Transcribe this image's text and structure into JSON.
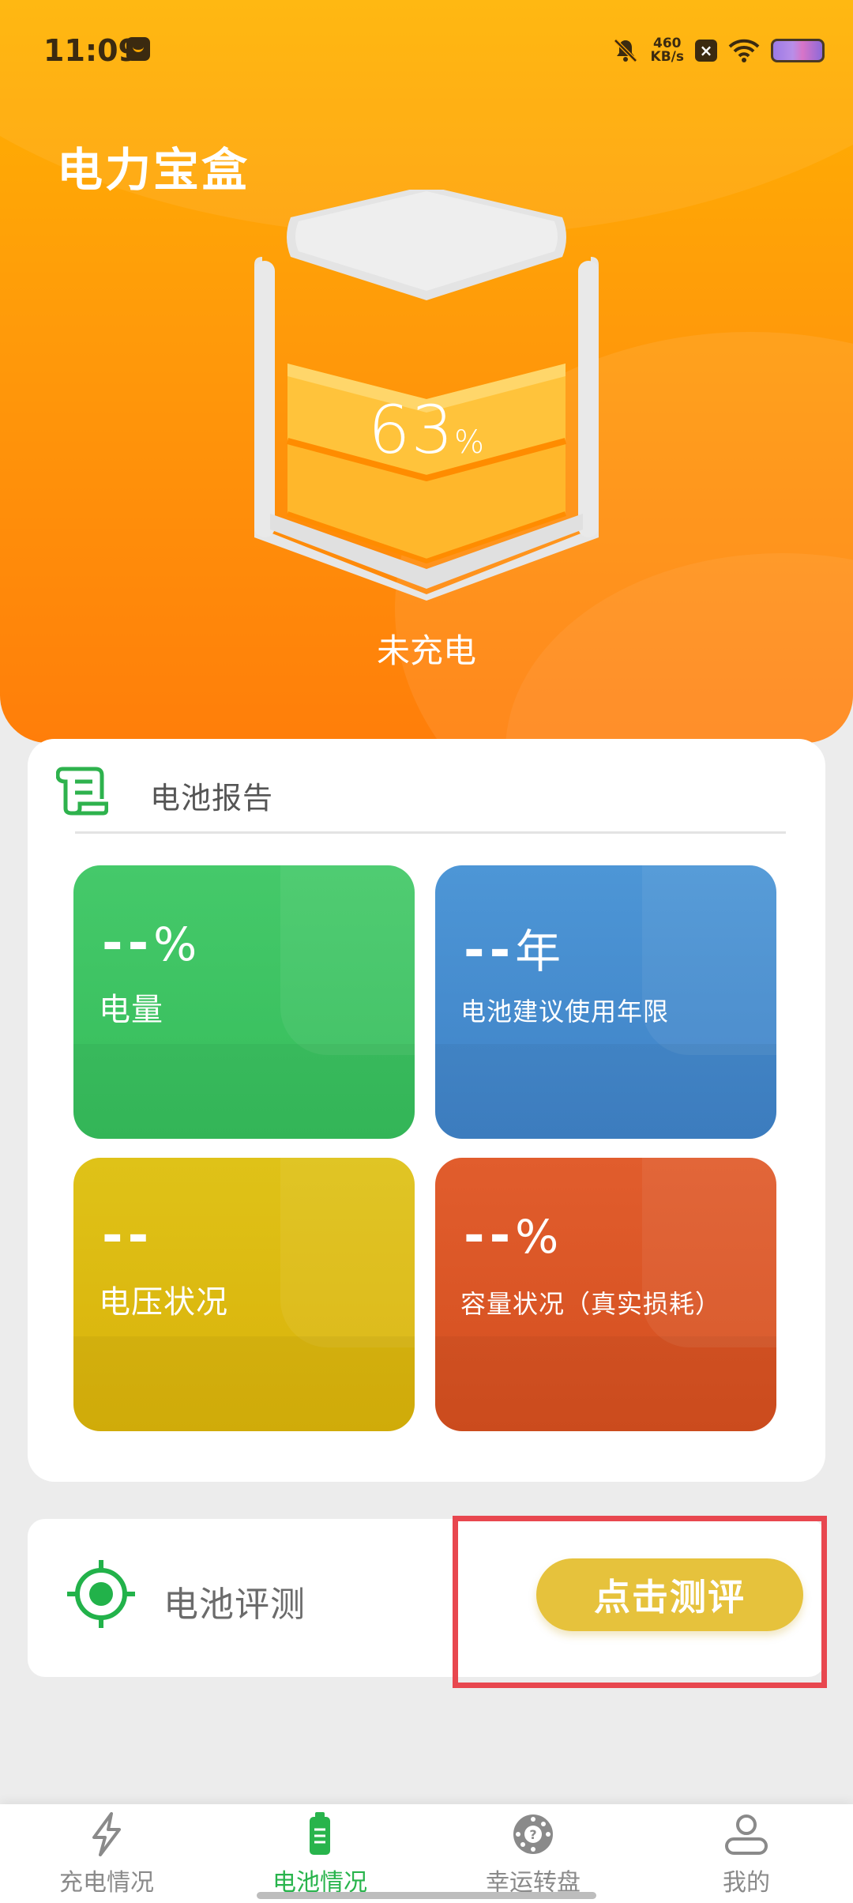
{
  "status_bar": {
    "time": "11:09",
    "net_speed_value": "460",
    "net_speed_unit": "KB/s"
  },
  "header": {
    "app_title": "电力宝盒",
    "battery_percent": "63",
    "percent_sign": "%",
    "charge_status": "未充电"
  },
  "report": {
    "title": "电池报告",
    "tiles": [
      {
        "value": "--",
        "unit": "%",
        "label": "电量",
        "color": "#3cc562"
      },
      {
        "value": "--",
        "unit": "年",
        "label": "电池建议使用年限",
        "color": "#4690d2"
      },
      {
        "value": "--",
        "unit": "",
        "label": "电压状况",
        "color": "#dbbb12"
      },
      {
        "value": "--",
        "unit": "%",
        "label": "容量状况（真实损耗）",
        "color": "#dc5626"
      }
    ]
  },
  "evaluation": {
    "label": "电池评测",
    "button_label": "点击测评",
    "button_color": "#e6c23c"
  },
  "bottom_nav": {
    "items": [
      {
        "label": "充电情况",
        "icon": "lightning-icon",
        "active": false
      },
      {
        "label": "电池情况",
        "icon": "battery-icon",
        "active": true
      },
      {
        "label": "幸运转盘",
        "icon": "wheel-icon",
        "active": false
      },
      {
        "label": "我的",
        "icon": "user-icon",
        "active": false
      }
    ],
    "active_color": "#28b44c"
  },
  "colors": {
    "header_top": "#ffb300",
    "header_bottom": "#ff7e0a",
    "highlight": "#e8474f"
  }
}
